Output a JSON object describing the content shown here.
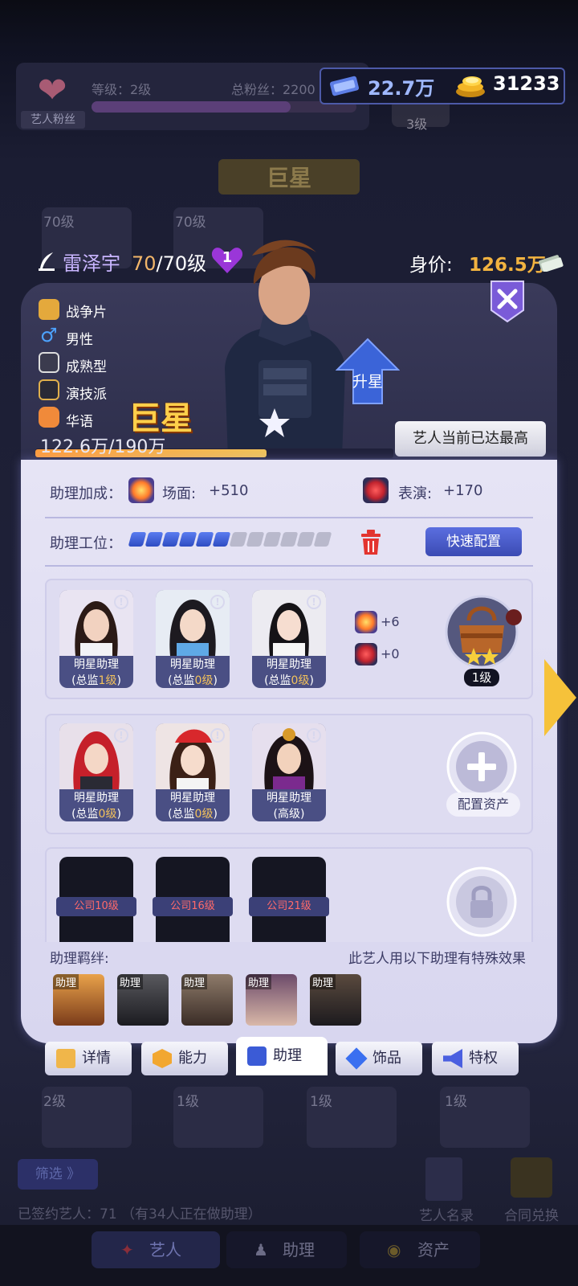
{
  "currency": {
    "tickets": "22.7万",
    "coins": "31233"
  },
  "background": {
    "fan_label": "艺人粉丝",
    "level_text": "等级：2级",
    "fans_text": "总粉丝：2200",
    "company_level": "3级",
    "banner": "巨星",
    "top_cards": [
      "70级",
      "70级"
    ],
    "bottom_cards": [
      "2级",
      "1级",
      "1级",
      "1级"
    ],
    "filter": "筛选 》",
    "signed": "已签约艺人：71 （有34人正在做助理）",
    "roster": "艺人名录",
    "contract_exchange": "合同兑换",
    "bottom_tabs": [
      "艺人",
      "助理",
      "资产"
    ]
  },
  "artist": {
    "name": "雷泽宇",
    "level_current": "70",
    "level_max": "/70级",
    "hearts": "1",
    "value_label": "身价:",
    "value": "126.5万",
    "attributes": [
      "战争片",
      "男性",
      "成熟型",
      "演技派",
      "华语"
    ],
    "tier_title": "巨星",
    "xp_text": "122.6万/190万",
    "xp_progress": 0.645,
    "upgrade_label": "升星",
    "max_notice": "艺人当前已达最高"
  },
  "assistant_panel": {
    "bonus_label": "助理加成：",
    "scene_label": "场面:",
    "scene_value": "+510",
    "acting_label": "表演:",
    "acting_value": "+170",
    "slots_label": "助理工位：",
    "slots_filled": 6,
    "slots_total": 12,
    "quick_config": "快速配置",
    "group1": {
      "assistants": [
        {
          "name": "明星助理",
          "sub_prefix": "(总监",
          "sub_level": "1级",
          "sub_suffix": ")"
        },
        {
          "name": "明星助理",
          "sub_prefix": "(总监",
          "sub_level": "0级",
          "sub_suffix": ")"
        },
        {
          "name": "明星助理",
          "sub_prefix": "(总监",
          "sub_level": "0级",
          "sub_suffix": ")"
        }
      ],
      "scene_bonus": "+6",
      "acting_bonus": "+0",
      "asset_level": "1级",
      "asset_stars": 2
    },
    "group2": {
      "assistants": [
        {
          "name": "明星助理",
          "sub_prefix": "(总监",
          "sub_level": "0级",
          "sub_suffix": ")"
        },
        {
          "name": "明星助理",
          "sub_prefix": "(总监",
          "sub_level": "0级",
          "sub_suffix": ")"
        },
        {
          "name": "明星助理",
          "sub_prefix": "(",
          "sub_level": "",
          "sub_suffix": "高级)"
        }
      ],
      "config_asset": "配置资产"
    },
    "group3": {
      "locks": [
        "公司10级",
        "公司16级",
        "公司21级"
      ]
    },
    "bonds_title": "助理羁绊:",
    "bonds_note": "此艺人用以下助理有特殊效果",
    "bond_tag": "助理"
  },
  "tabs": [
    "详情",
    "能力",
    "助理",
    "饰品",
    "特权"
  ]
}
